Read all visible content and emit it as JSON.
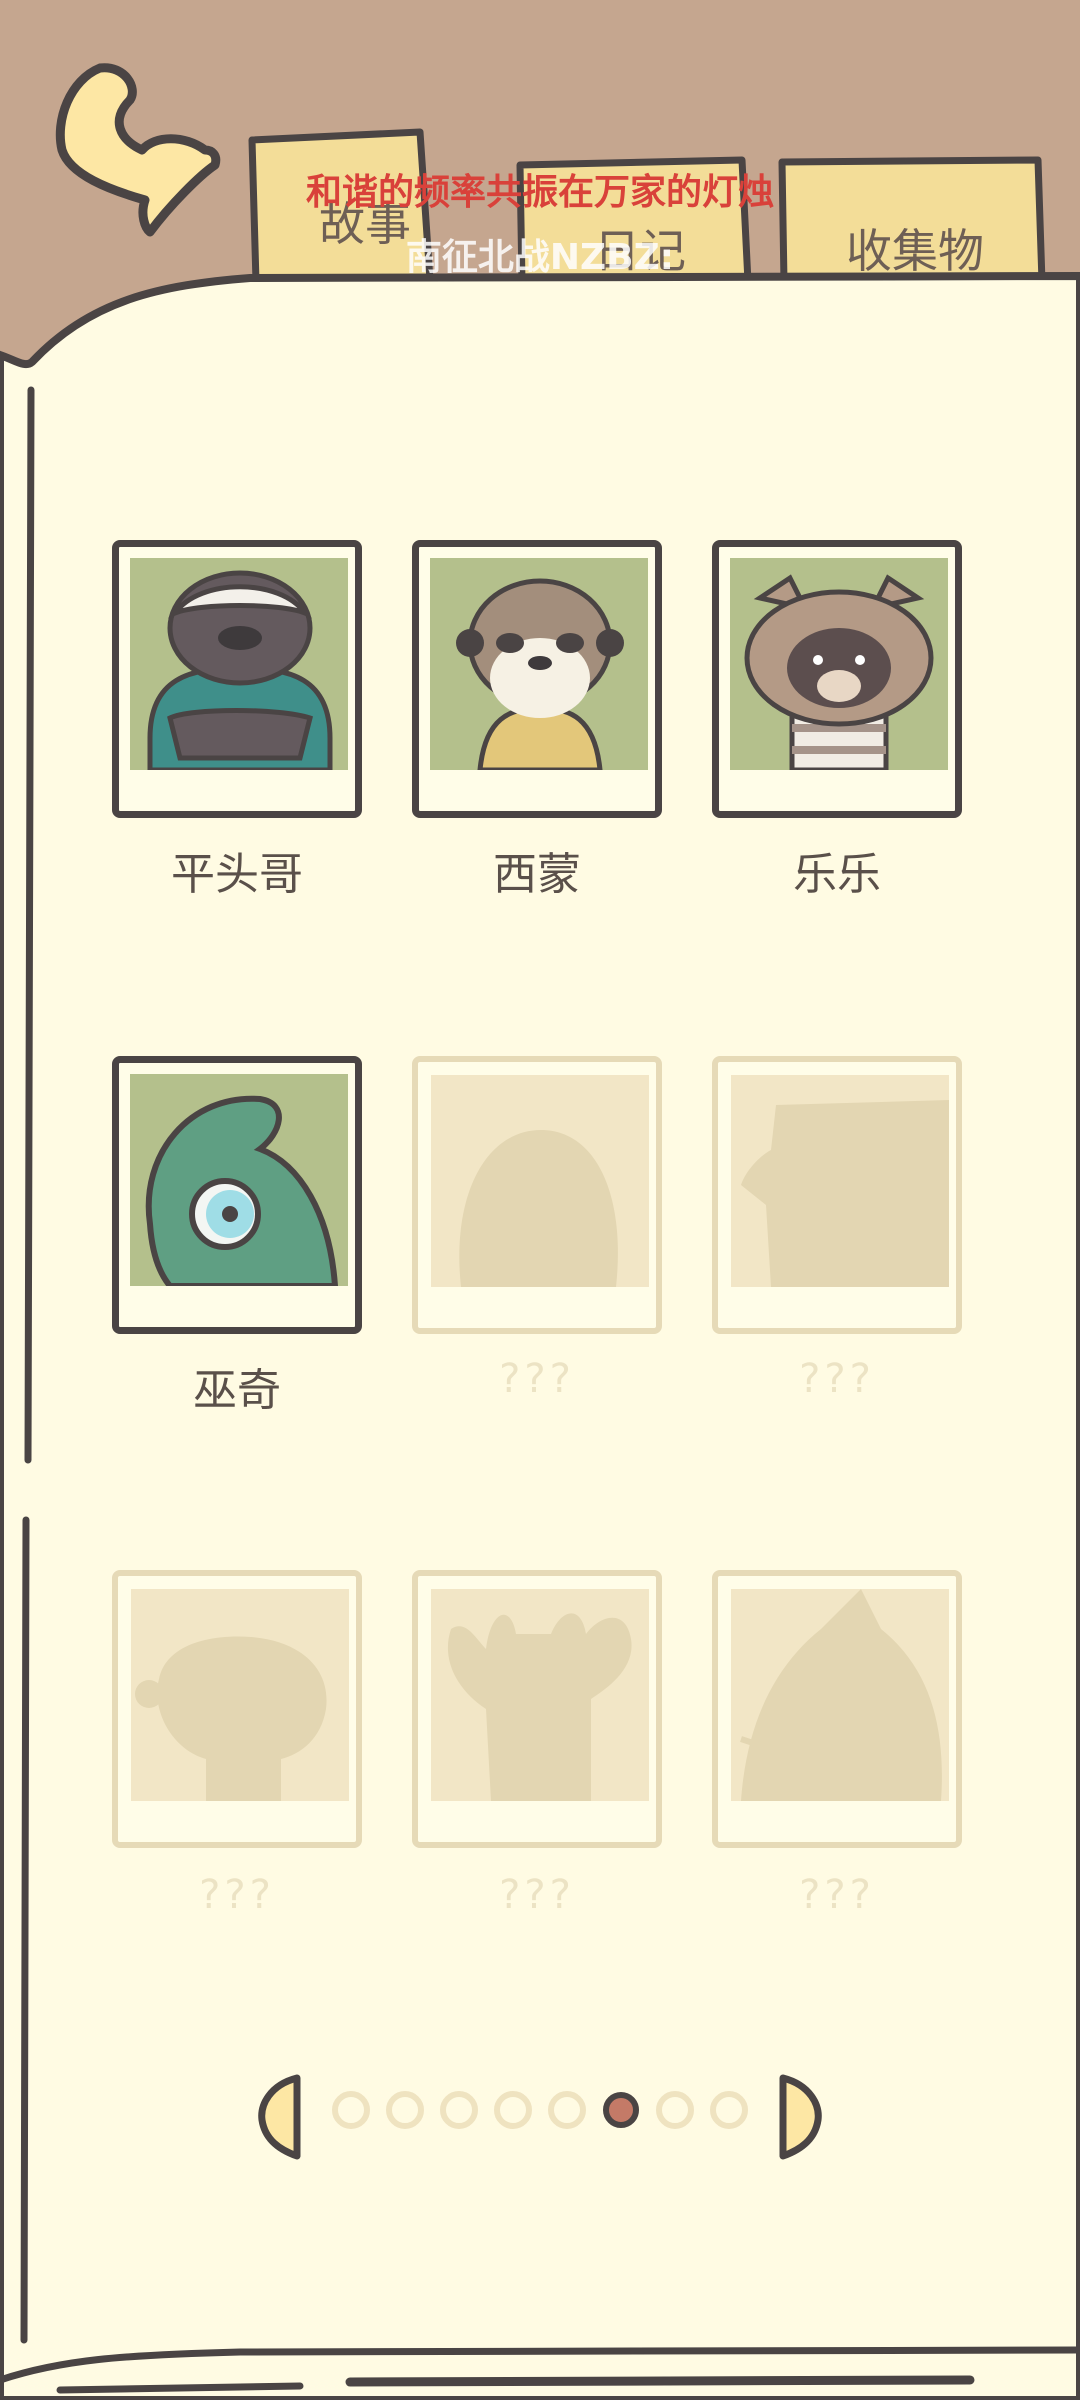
{
  "tabs": [
    {
      "label": "故事"
    },
    {
      "label": "日记"
    },
    {
      "label": "收集物"
    }
  ],
  "overlay": {
    "red_caption": "和谐的频率共振在万家的灯烛",
    "white_caption": "南征北战NZBZ:"
  },
  "characters": [
    {
      "name": "平头哥",
      "unlocked": true
    },
    {
      "name": "西蒙",
      "unlocked": true
    },
    {
      "name": "乐乐",
      "unlocked": true
    },
    {
      "name": "巫奇",
      "unlocked": true
    },
    {
      "name": "???",
      "unlocked": false
    },
    {
      "name": "???",
      "unlocked": false
    },
    {
      "name": "???",
      "unlocked": false
    },
    {
      "name": "???",
      "unlocked": false
    },
    {
      "name": "???",
      "unlocked": false
    }
  ],
  "pagination": {
    "total_pages": 8,
    "current_page": 6
  },
  "colors": {
    "background_brown": "#c5a68f",
    "page_cream": "#fffbe3",
    "tab_yellow": "#f3dd98",
    "outline": "#4a4444",
    "photo_green": "#b4c08c",
    "active_dot": "#c47a67"
  }
}
